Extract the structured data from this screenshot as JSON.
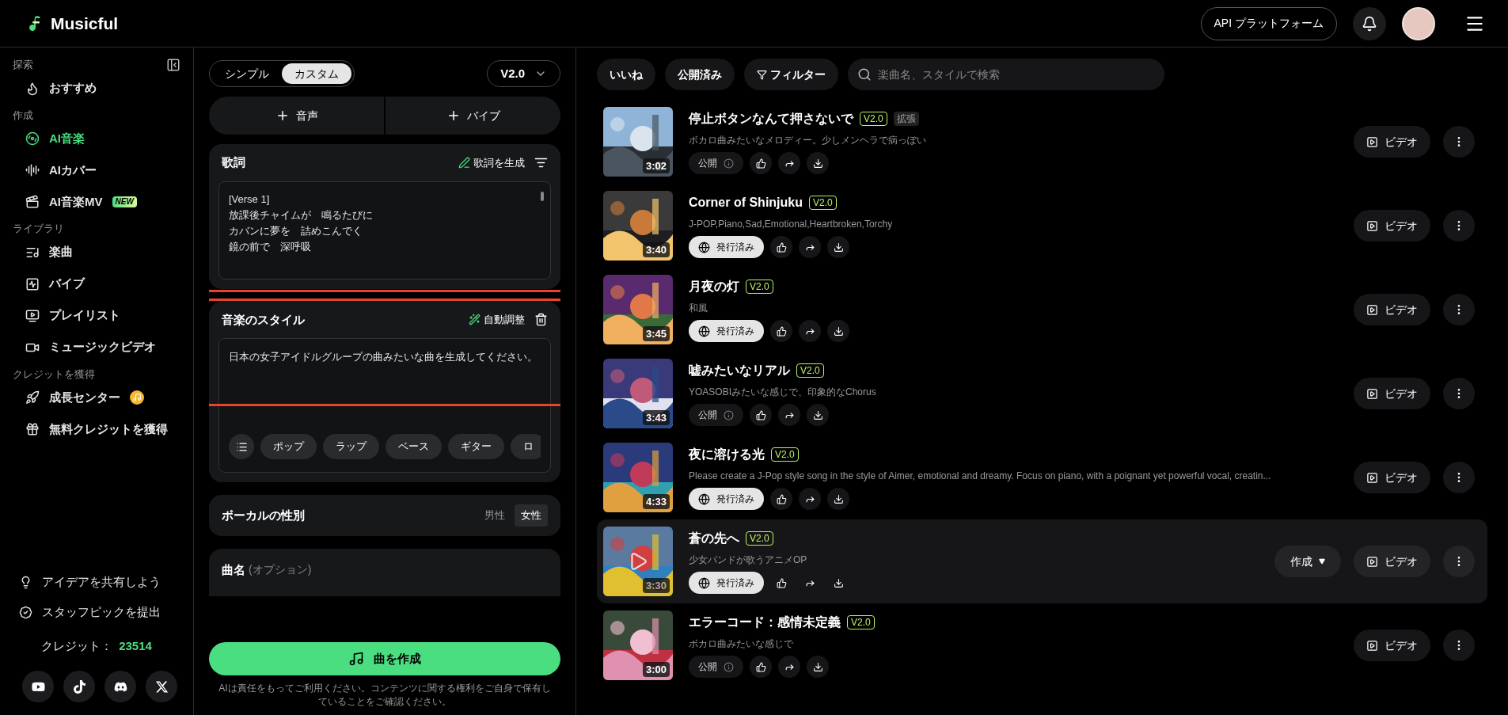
{
  "header": {
    "brand": "Musicful",
    "api_button": "API プラットフォーム"
  },
  "sidebar": {
    "sections": [
      {
        "title": "探索",
        "items": [
          {
            "label": "おすすめ",
            "selected": false
          }
        ]
      },
      {
        "title": "作成",
        "items": [
          {
            "label": "AI音楽",
            "selected": true
          },
          {
            "label": "AIカバー",
            "selected": false
          },
          {
            "label": "AI音楽MV",
            "selected": false,
            "badge": "NEW"
          }
        ]
      },
      {
        "title": "ライブラリ",
        "items": [
          {
            "label": "楽曲",
            "selected": false
          },
          {
            "label": "バイブ",
            "selected": false
          },
          {
            "label": "プレイリスト",
            "selected": false
          },
          {
            "label": "ミュージックビデオ",
            "selected": false
          }
        ]
      },
      {
        "title": "クレジットを獲得",
        "items": [
          {
            "label": "成長センター",
            "selected": false,
            "coin": true
          },
          {
            "label": "無料クレジットを獲得",
            "selected": false
          }
        ]
      }
    ],
    "footer_links": [
      "アイデアを共有しよう",
      "スタッフピックを提出"
    ],
    "credits_label": "クレジット：",
    "credits_value": "23514"
  },
  "composer": {
    "modes": [
      {
        "label": "シンプル",
        "selected": false
      },
      {
        "label": "カスタム",
        "selected": true
      }
    ],
    "version": "V2.0",
    "add_buttons": [
      "音声",
      "バイブ"
    ],
    "lyrics": {
      "title": "歌詞",
      "action": "歌詞を生成",
      "highlighted": true,
      "lines": [
        "[Verse 1]",
        "放課後チャイムが　鳴るたびに",
        "カバンに夢を　詰めこんでく",
        "鏡の前で　深呼吸"
      ]
    },
    "style": {
      "title": "音楽のスタイル",
      "action": "自動調整",
      "highlighted": true,
      "value": "日本の女子アイドルグループの曲みたいな曲を生成してください。",
      "chips": [
        "ポップ",
        "ラップ",
        "ベース",
        "ギター",
        "ロ"
      ]
    },
    "vocal": {
      "title": "ボーカルの性別",
      "options": [
        {
          "label": "男性",
          "selected": false
        },
        {
          "label": "女性",
          "selected": true
        }
      ]
    },
    "song_name": {
      "title": "曲名",
      "hint": "(オプション)"
    },
    "create_button": "曲を作成",
    "disclaimer": "AIは責任をもってご利用ください。コンテンツに関する権利をご自身で保有していることをご確認ください。"
  },
  "library": {
    "filters": [
      "いいね",
      "公開済み",
      "フィルター"
    ],
    "search": {
      "placeholder": "楽曲名、スタイルで検索"
    },
    "songs": [
      {
        "title": "停止ボタンなんて押さないで",
        "version": "V2.0",
        "extra_tag": "拡張",
        "description": "ボカロ曲みたいなメロディー。少しメンヘラで病っぽい",
        "duration": "3:02",
        "status": {
          "kind": "public",
          "label": "公開"
        },
        "selected": false,
        "video_button": "ビデオ"
      },
      {
        "title": "Corner of Shinjuku",
        "version": "V2.0",
        "description": "J-POP,Piano,Sad,Emotional,Heartbroken,Torchy",
        "duration": "3:40",
        "status": {
          "kind": "published",
          "label": "発行済み"
        },
        "selected": false,
        "video_button": "ビデオ"
      },
      {
        "title": "月夜の灯",
        "version": "V2.0",
        "description": "和風",
        "duration": "3:45",
        "status": {
          "kind": "published",
          "label": "発行済み"
        },
        "selected": false,
        "video_button": "ビデオ"
      },
      {
        "title": "嘘みたいなリアル",
        "version": "V2.0",
        "description": "YOASOBIみたいな感じで、印象的なChorus",
        "duration": "3:43",
        "status": {
          "kind": "public",
          "label": "公開"
        },
        "selected": false,
        "video_button": "ビデオ"
      },
      {
        "title": "夜に溶ける光",
        "version": "V2.0",
        "description": "Please create a J-Pop style song in the style of Aimer, emotional and dreamy. Focus on piano, with a poignant yet powerful vocal, creatin...",
        "duration": "4:33",
        "status": {
          "kind": "published",
          "label": "発行済み"
        },
        "selected": false,
        "video_button": "ビデオ"
      },
      {
        "title": "蒼の先へ",
        "version": "V2.0",
        "description": "少女バンドが歌うアニメOP",
        "duration": "3:30",
        "status": {
          "kind": "published",
          "label": "発行済み"
        },
        "selected": true,
        "create_menu": "作成",
        "video_button": "ビデオ"
      },
      {
        "title": "エラーコード：感情未定義",
        "version": "V2.0",
        "description": "ボカロ曲みたいな感じで",
        "duration": "3:00",
        "status": {
          "kind": "public",
          "label": "公開"
        },
        "selected": false,
        "video_button": "ビデオ"
      }
    ]
  }
}
